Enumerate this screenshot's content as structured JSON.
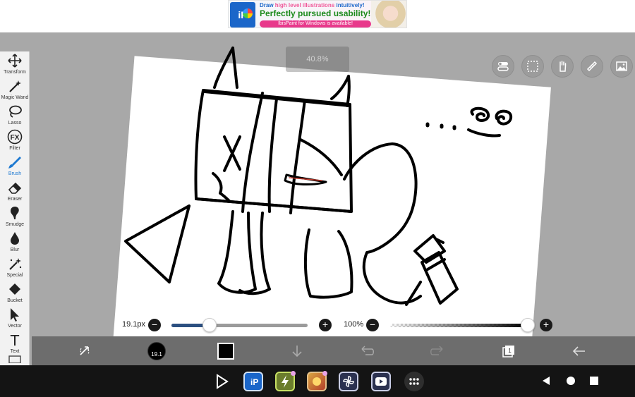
{
  "ad": {
    "line1_a": "Draw ",
    "line1_b": "high level illustrations",
    "line1_c": " intuitively!",
    "headline": "Perfectly pursued usability!",
    "sub": "IbisPaint for Windows is available!",
    "logo_text": "iP"
  },
  "canvas": {
    "zoom_text": "40.8%"
  },
  "top_tools": [
    {
      "name": "toggle-icon"
    },
    {
      "name": "selection-icon"
    },
    {
      "name": "hand-icon"
    },
    {
      "name": "ruler-icon"
    },
    {
      "name": "image-icon"
    }
  ],
  "toolbar": {
    "items": [
      {
        "label": "Transform",
        "icon": "move-icon"
      },
      {
        "label": "Magic Wand",
        "icon": "magic-wand-icon"
      },
      {
        "label": "Lasso",
        "icon": "lasso-icon"
      },
      {
        "label": "Filter",
        "icon": "fx-icon",
        "glyph": "FX"
      },
      {
        "label": "Brush",
        "icon": "brush-icon",
        "active": true
      },
      {
        "label": "Eraser",
        "icon": "eraser-icon"
      },
      {
        "label": "Smudge",
        "icon": "smudge-icon"
      },
      {
        "label": "Blur",
        "icon": "drop-icon"
      },
      {
        "label": "Special",
        "icon": "special-icon"
      },
      {
        "label": "Bucket",
        "icon": "bucket-icon"
      },
      {
        "label": "Vector",
        "icon": "cursor-icon"
      },
      {
        "label": "Text",
        "icon": "text-icon",
        "glyph": "T"
      }
    ]
  },
  "brush": {
    "size_label": "19.1px",
    "size_fraction": 0.28,
    "opacity_label": "100%",
    "opacity_fraction": 1.0,
    "minus": "−",
    "plus": "+"
  },
  "bottom_bar": {
    "brush_size_badge": "19.1",
    "current_color": "#000000"
  },
  "colors": {
    "accent": "#1f7ad1",
    "slider_track": "#2b4f80",
    "toolbar_bg": "#f2f2f2",
    "bottom_bar_bg": "#6d6d6d"
  },
  "dock": [
    {
      "name": "play-store-app-icon"
    },
    {
      "name": "ibispaint-app-icon"
    },
    {
      "name": "flash-app-icon"
    },
    {
      "name": "game-app-icon"
    },
    {
      "name": "pinwheel-app-icon"
    },
    {
      "name": "youtube-app-icon"
    },
    {
      "name": "app-drawer-icon"
    }
  ]
}
